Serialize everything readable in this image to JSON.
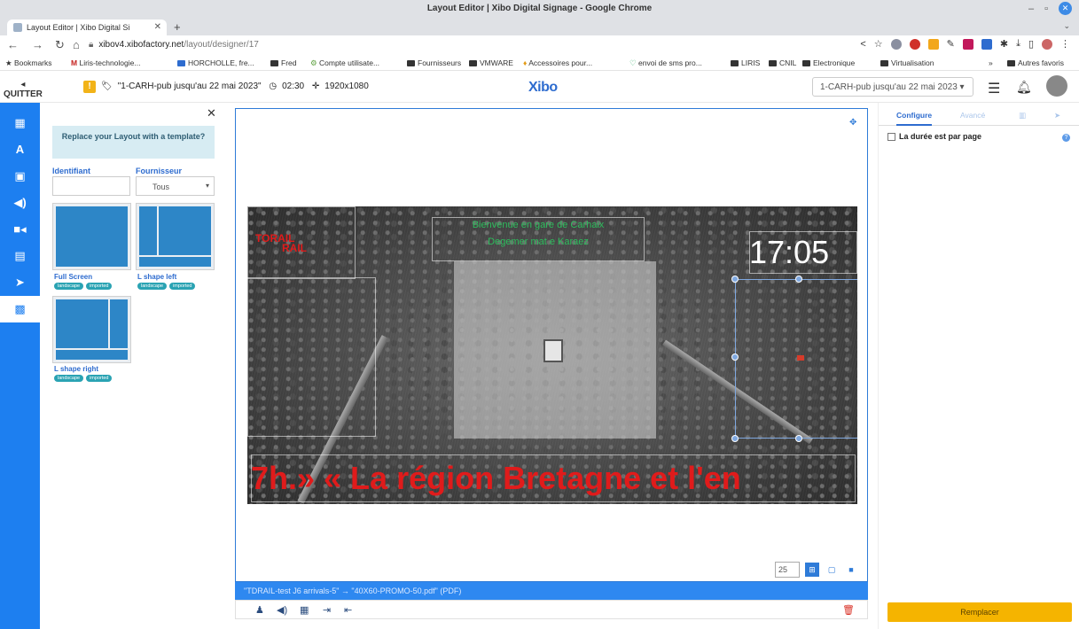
{
  "browser": {
    "window_title": "Layout Editor | Xibo Digital Signage - Google Chrome",
    "tab_title": "Layout Editor | Xibo Digital Si",
    "url_host": "xibov4.xibofactory.net",
    "url_path": "/layout/designer/17",
    "bookmarks": [
      "Bookmarks",
      "Liris-technologie...",
      "HORCHOLLE, fre...",
      "Fred",
      "Compte utilisate...",
      "Fournisseurs",
      "VMWARE",
      "Accessoires pour...",
      "envoi de sms pro...",
      "LIRIS",
      "CNIL",
      "Electronique",
      "Virtualisation",
      "Autres favoris"
    ]
  },
  "toolbar": {
    "quit_label": "QUITTER",
    "warning": "!",
    "layout_name": "\"1-CARH-pub jusqu'au 22 mai 2023\"",
    "duration": "02:30",
    "resolution": "1920x1080",
    "logo": "Xibo",
    "layout_select": "1-CARH-pub jusqu'au 22 mai 2023"
  },
  "template_panel": {
    "header": "Replace your Layout with a template?",
    "label_identifiant": "Identifiant",
    "label_fournisseur": "Fournisseur",
    "fournisseur_value": "Tous",
    "templates": [
      {
        "name": "Full Screen",
        "tags": [
          "landscape",
          "imported"
        ]
      },
      {
        "name": "L shape left",
        "tags": [
          "landscape",
          "imported"
        ]
      },
      {
        "name": "L shape right",
        "tags": [
          "landscape",
          "imported"
        ]
      }
    ]
  },
  "canvas": {
    "welcome_line1": "Bienvenue en gare de Carhaix",
    "welcome_line2": "Degemer mat e Karaez",
    "clock": "17:05",
    "logo_line1": "TORAIL",
    "logo_line2": "RAIL",
    "ticker": "7h.» « La région Bretagne et l'en",
    "zoom": "25"
  },
  "timeline": {
    "text": "\"TDRAIL-test J6 arrivals-5\"  →  \"40X60-PROMO-50.pdf\" (PDF)"
  },
  "properties": {
    "tabs": [
      "Configure",
      "Avancé",
      "",
      ""
    ],
    "checkbox_label": "La durée est par page",
    "replace_button": "Remplacer"
  }
}
